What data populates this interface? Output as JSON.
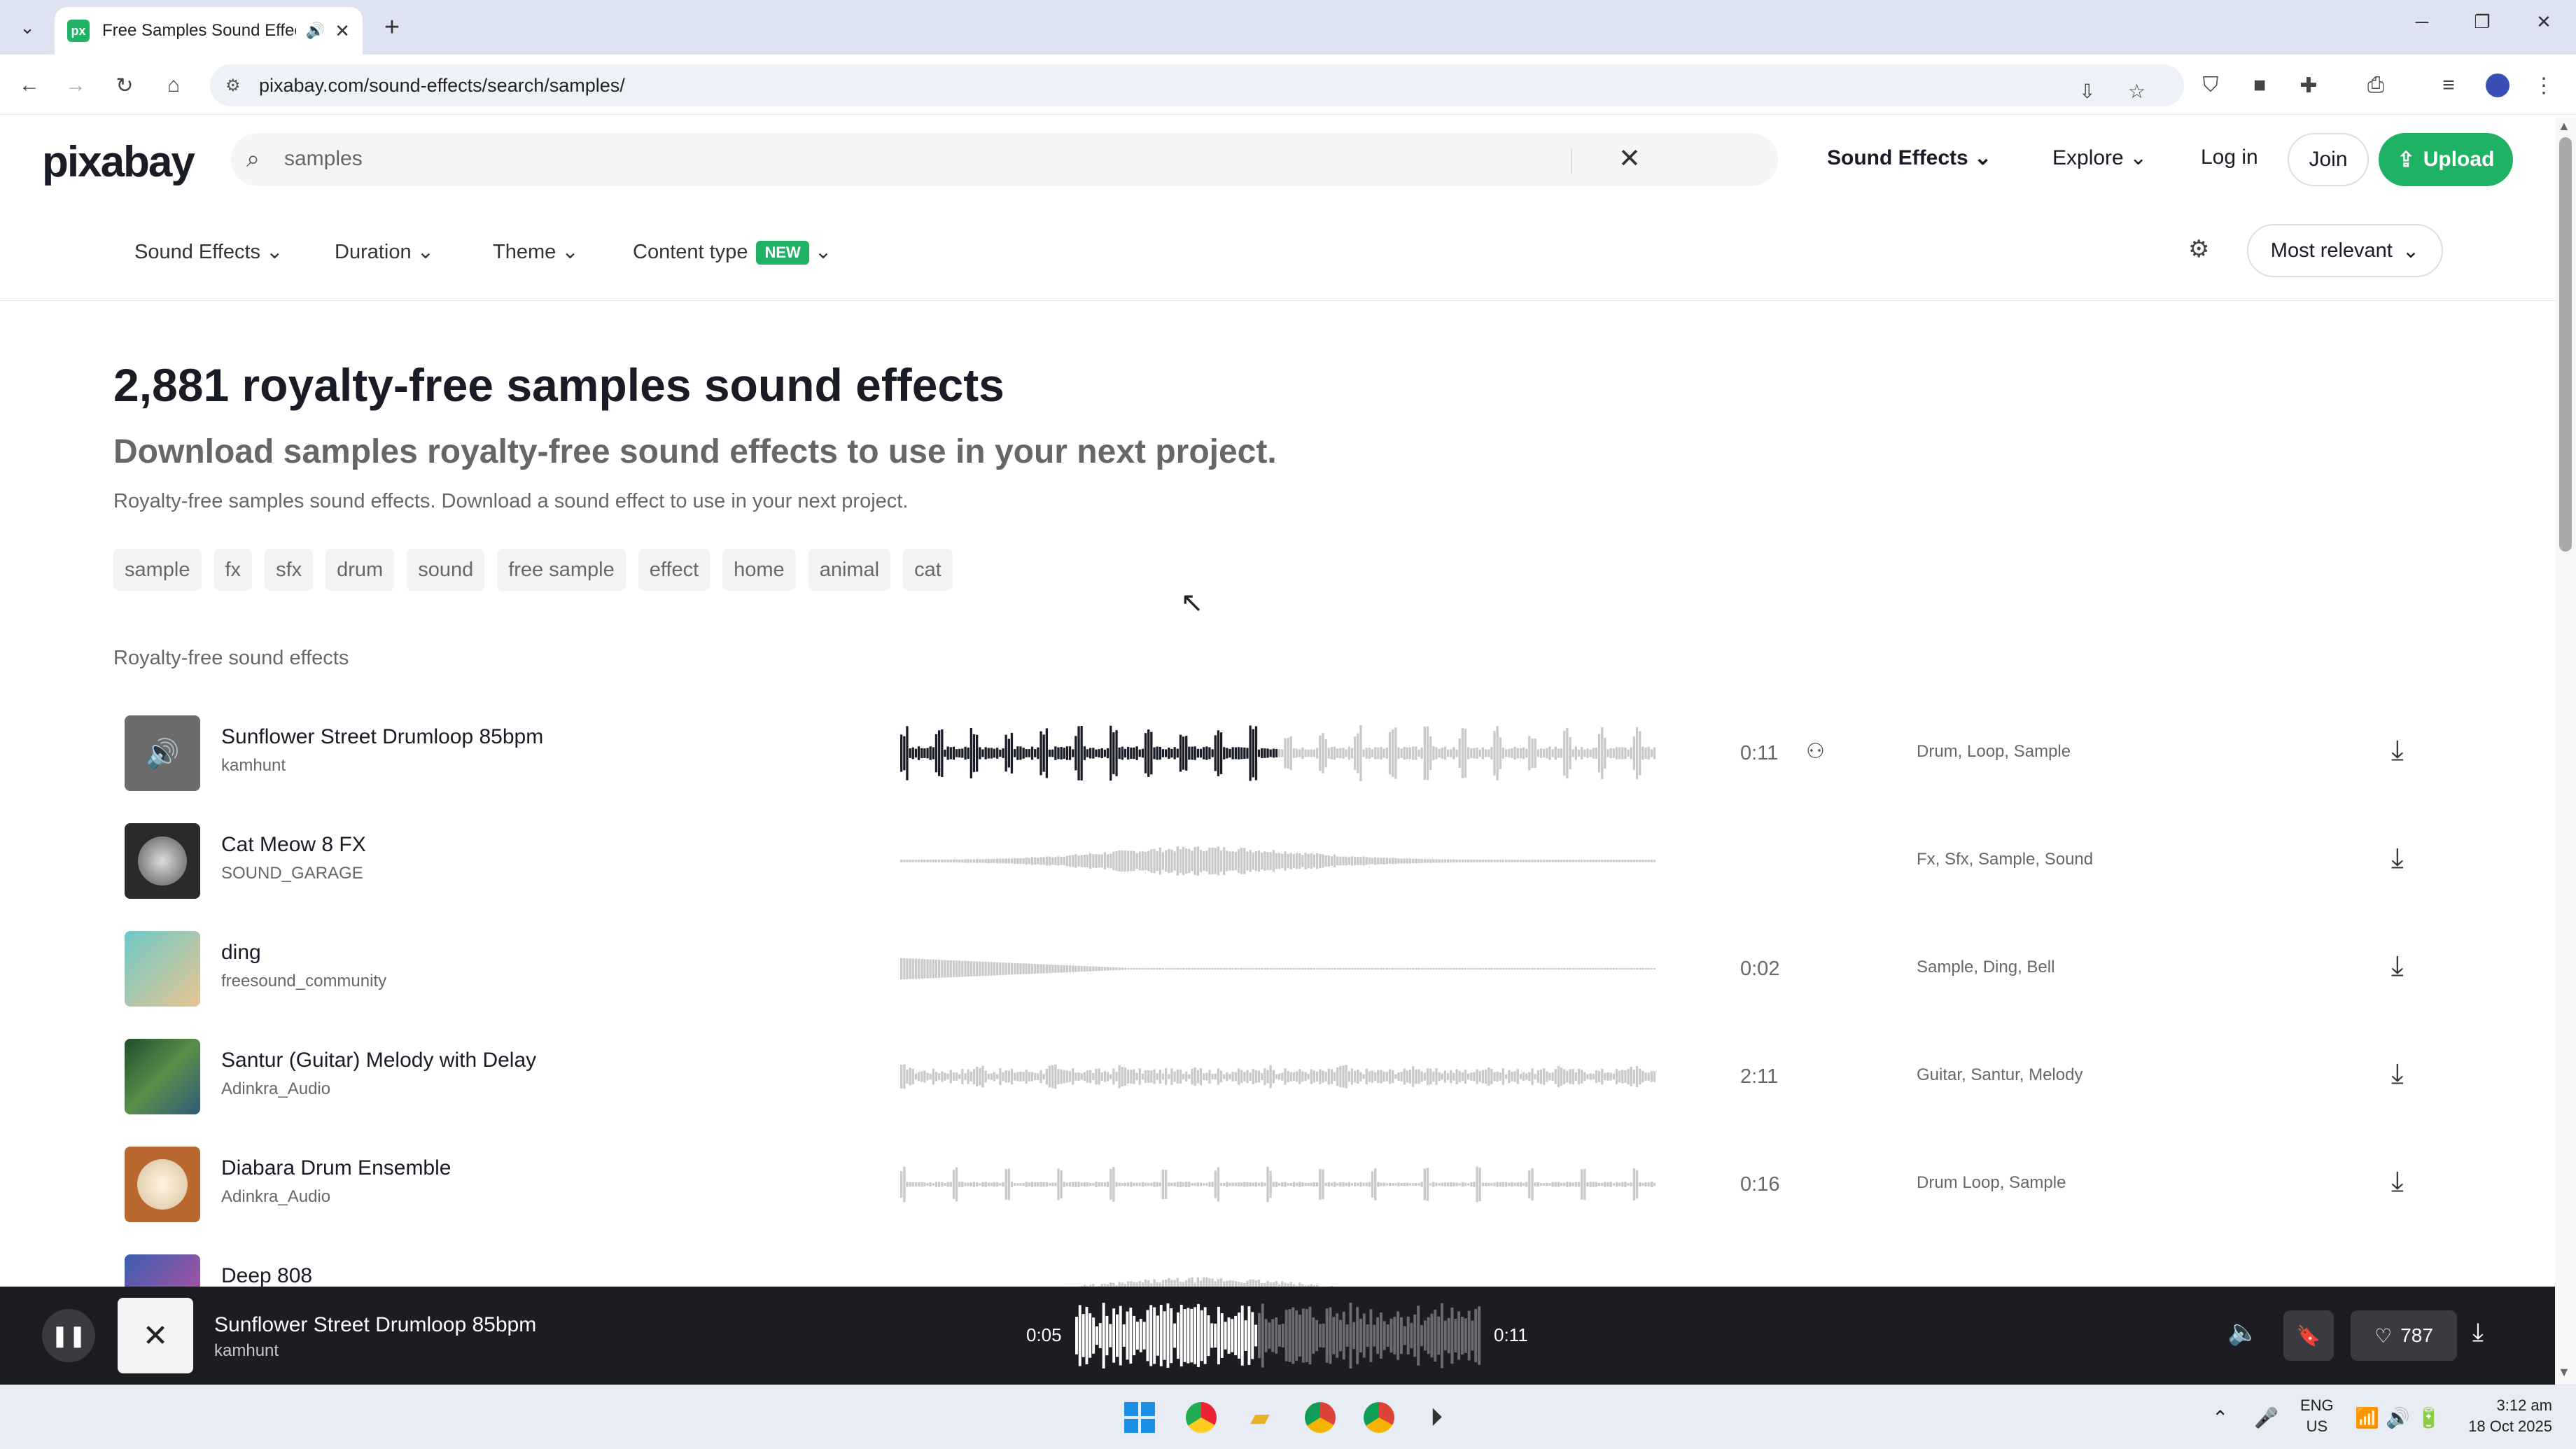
{
  "browser": {
    "tab_title": "Free Samples Sound Effects",
    "url": "pixabay.com/sound-effects/search/samples/"
  },
  "header": {
    "logo": "pixabay",
    "search_value": "samples",
    "search_type": "Sound Effects",
    "explore": "Explore",
    "login": "Log in",
    "join": "Join",
    "upload": "Upload"
  },
  "filters": {
    "items": [
      "Sound Effects",
      "Duration",
      "Theme",
      "Content type"
    ],
    "new_badge": "NEW",
    "sort": "Most relevant"
  },
  "main": {
    "title": "2,881 royalty-free samples sound effects",
    "subtitle": "Download samples royalty-free sound effects to use in your next project.",
    "description": "Royalty-free samples sound effects. Download a sound effect to use in your next project.",
    "tags": [
      "sample",
      "fx",
      "sfx",
      "drum",
      "sound",
      "free sample",
      "effect",
      "home",
      "animal",
      "cat"
    ],
    "section_label": "Royalty-free sound effects"
  },
  "tracks": [
    {
      "title": "Sunflower Street Drumloop 85bpm",
      "author": "kamhunt",
      "duration": "0:11",
      "tags": "Drum, Loop, Sample",
      "playing": true,
      "progress": 0.5,
      "thumb_color": "#6b6b6b"
    },
    {
      "title": "Cat Meow 8 FX",
      "author": "SOUND_GARAGE",
      "duration": "",
      "tags": "Fx, Sfx, Sample, Sound",
      "playing": false,
      "thumb_color": "#2a2a2a"
    },
    {
      "title": "ding",
      "author": "freesound_community",
      "duration": "0:02",
      "tags": "Sample, Ding, Bell",
      "playing": false,
      "thumb_color": "#7fc7c0"
    },
    {
      "title": "Santur (Guitar) Melody with Delay",
      "author": "Adinkra_Audio",
      "duration": "2:11",
      "tags": "Guitar, Santur, Melody",
      "playing": false,
      "thumb_color": "#2f5a3a"
    },
    {
      "title": "Diabara Drum Ensemble",
      "author": "Adinkra_Audio",
      "duration": "0:16",
      "tags": "Drum Loop, Sample",
      "playing": false,
      "thumb_color": "#b9682f"
    },
    {
      "title": "Deep 808",
      "author": "",
      "duration": "",
      "tags": "",
      "playing": false,
      "thumb_color": "#3b5fb0"
    }
  ],
  "player": {
    "title": "Sunflower Street Drumloop 85bpm",
    "author": "kamhunt",
    "current_time": "0:05",
    "total_time": "0:11",
    "progress": 0.45,
    "likes": "787"
  },
  "taskbar": {
    "lang_top": "ENG",
    "lang_bottom": "US",
    "time": "3:12 am",
    "date": "18 Oct 2025"
  },
  "colors": {
    "accent": "#1fb264",
    "player_bg": "#1c1d22"
  }
}
